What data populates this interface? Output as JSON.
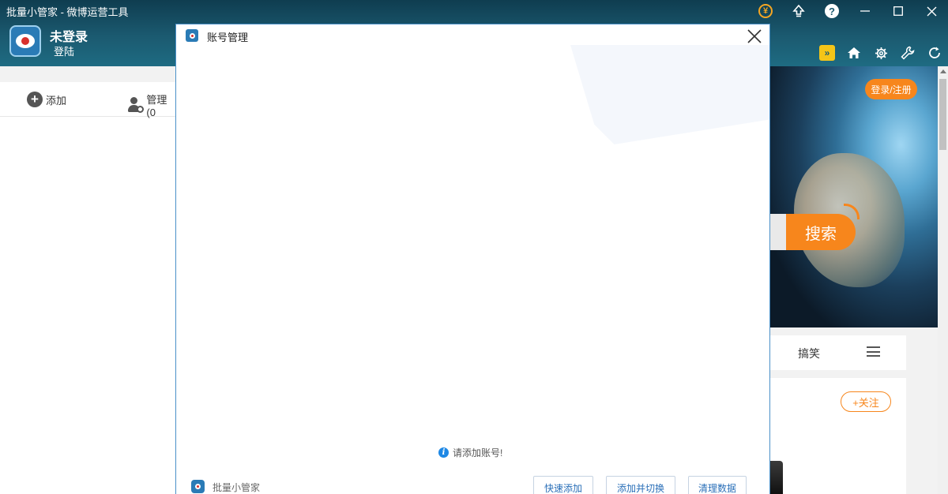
{
  "window": {
    "title": "批量小管家 - 微博运营工具",
    "controls": [
      "coin-icon",
      "upload-icon",
      "help-icon",
      "minimize-icon",
      "maximize-icon",
      "close-icon"
    ]
  },
  "header": {
    "user_name": "未登录",
    "login_label": "登陆",
    "tool_icons": [
      "vip-icon",
      "home-icon",
      "gear-icon",
      "wrench-icon",
      "refresh-icon"
    ]
  },
  "left_toolbar": {
    "add_label": "添加",
    "manage_label": "管理(0"
  },
  "dialog": {
    "title": "账号管理",
    "empty_message": "请添加账号!",
    "footer_name": "批量小管家",
    "buttons": {
      "quick_add": "快速添加",
      "add_switch": "添加并切换",
      "clear_data": "清理数据"
    }
  },
  "right_panel": {
    "login_register": "登录/注册",
    "search_button": "搜索",
    "category_label": "搞笑",
    "follow_button": "+关注"
  },
  "colors": {
    "header_bg": "#1b5a70",
    "accent_orange": "#f7861c",
    "dialog_border": "#4a90c8",
    "button_text": "#2a6fb8"
  }
}
